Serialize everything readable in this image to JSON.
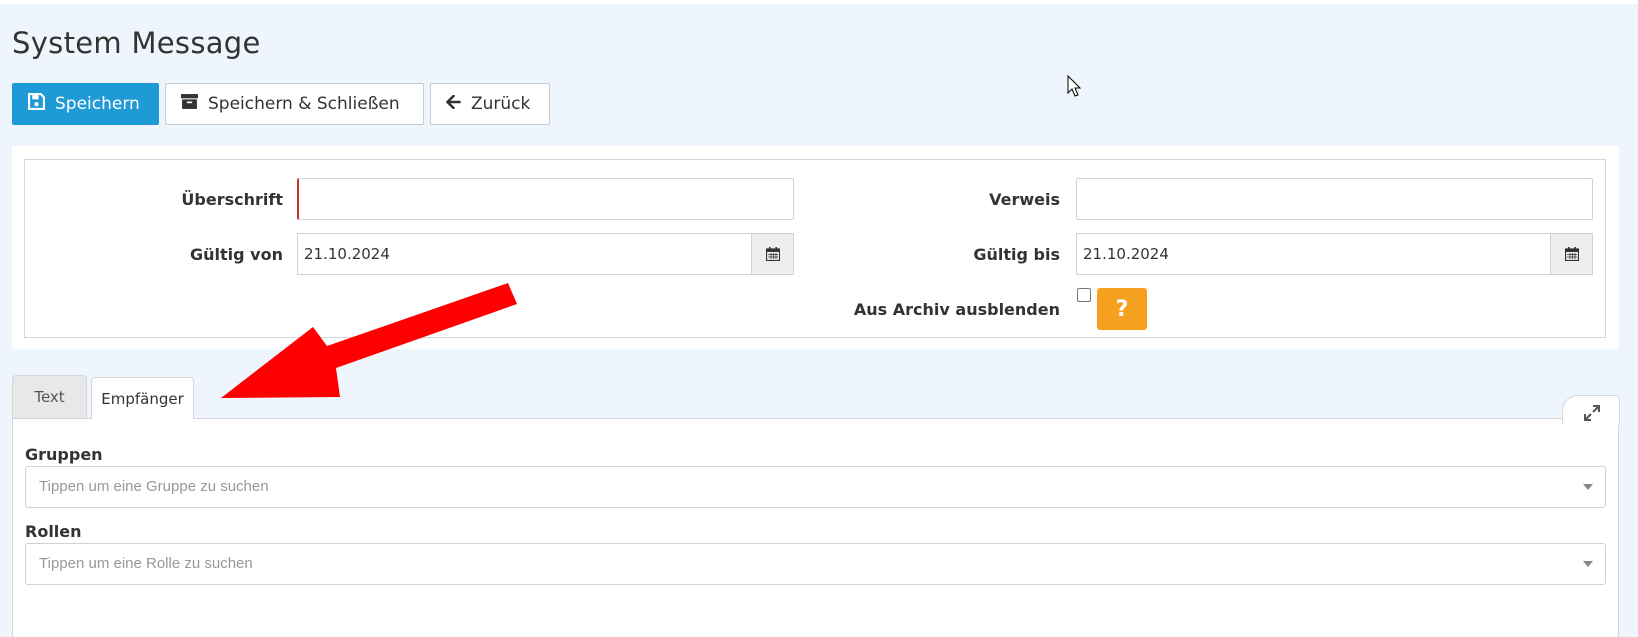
{
  "page": {
    "title": "System Message"
  },
  "toolbar": {
    "save_label": "Speichern",
    "save_close_label": "Speichern & Schließen",
    "back_label": "Zurück"
  },
  "form": {
    "heading_label": "Überschrift",
    "heading_value": "",
    "reference_label": "Verweis",
    "reference_value": "",
    "valid_from_label": "Gültig von",
    "valid_from_value": "21.10.2024",
    "valid_to_label": "Gültig bis",
    "valid_to_value": "21.10.2024",
    "hide_archive_label": "Aus Archiv ausblenden",
    "hide_archive_checked": false,
    "help_label": "?"
  },
  "tabs": [
    {
      "label": "Text",
      "active": false
    },
    {
      "label": "Empfänger",
      "active": true
    }
  ],
  "recipients": {
    "groups_label": "Gruppen",
    "groups_placeholder": "Tippen um eine Gruppe zu suchen",
    "roles_label": "Rollen",
    "roles_placeholder": "Tippen um eine Rolle zu suchen"
  },
  "colors": {
    "primary": "#1e9ad6",
    "help": "#f5a11f",
    "required": "#c9302c",
    "annotation": "#ff0000",
    "background": "#eef5fd"
  },
  "icons": {
    "save": "floppy-disk-icon",
    "save_close": "archive-box-icon",
    "back": "arrow-left-icon",
    "calendar": "calendar-icon",
    "expand": "expand-arrows-icon",
    "dropdown": "caret-down-icon"
  }
}
